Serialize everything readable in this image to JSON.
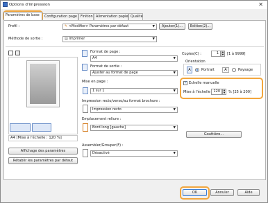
{
  "window": {
    "title": "Options d'impression"
  },
  "tabs": [
    {
      "label": "Paramètres de base"
    },
    {
      "label": "Configuration page"
    },
    {
      "label": "Finition"
    },
    {
      "label": "Alimentation papier"
    },
    {
      "label": "Qualité"
    }
  ],
  "profile": {
    "label": "Profil :",
    "value": "<Modifier> Paramètres par défaut",
    "add_button": "Ajouter(1)...",
    "edit_button": "Edition(2)..."
  },
  "output_method": {
    "label": "Méthode de sortie :",
    "value": "Imprimer"
  },
  "page_format": {
    "label": "Format de page :",
    "value": "A4"
  },
  "output_format": {
    "label": "Format de sortie :",
    "value": "Ajuster au format de page"
  },
  "layout": {
    "label": "Mise en page :",
    "value": "1 sur 1"
  },
  "duplex": {
    "label": "Impression recto/verso/au format brochure :",
    "value": "Impression recto"
  },
  "binding": {
    "label": "Emplacement reliure :",
    "value": "Bord long [gauche]"
  },
  "gutter_button": "Gouttière...",
  "finishing": {
    "label": "Assembler/Grouper(F) :",
    "value": "Désactivé"
  },
  "copies": {
    "label": "Copies(C) :",
    "value": "1",
    "range": "[1 à 9999]"
  },
  "orientation": {
    "label": "Orientation",
    "portrait": "Portrait",
    "landscape": "Paysage",
    "portrait_letter": "A",
    "landscape_letter": "A"
  },
  "manual_scaling": {
    "label": "Echelle manuelle",
    "checked": true
  },
  "scaling": {
    "label": "Mise à l'échelle :",
    "value": "120",
    "range": "% [25 à 200]"
  },
  "preview": {
    "caption": "A4 [Mise à l'échelle : 120 %]"
  },
  "left_buttons": {
    "show_settings": "Affichage des paramètres",
    "restore_defaults": "Rétablir les paramètres par défaut"
  },
  "footer": {
    "ok": "OK",
    "cancel": "Annuler",
    "help": "Aide"
  },
  "colors": {
    "highlight": "#f2a63c",
    "accent": "#1e6fd1"
  }
}
